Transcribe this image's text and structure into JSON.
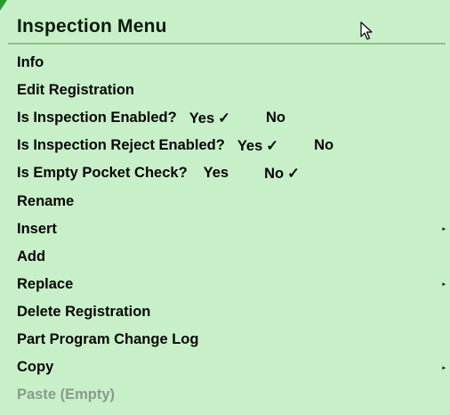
{
  "menu": {
    "title": "Inspection Menu",
    "items": [
      {
        "label": "Info"
      },
      {
        "label": "Edit Registration"
      },
      {
        "label": "Is Inspection Enabled?",
        "yes": "Yes",
        "no": "No",
        "checked": "yes",
        "check_glyph": "✓"
      },
      {
        "label": "Is Inspection Reject Enabled?",
        "yes": "Yes",
        "no": "No",
        "checked": "yes",
        "check_glyph": "✓"
      },
      {
        "label": "Is Empty Pocket Check?",
        "yes": "Yes",
        "no": "No",
        "checked": "no",
        "check_glyph": "✓"
      },
      {
        "label": "Rename"
      },
      {
        "label": "Insert",
        "submenu": true
      },
      {
        "label": "Add"
      },
      {
        "label": "Replace",
        "submenu": true
      },
      {
        "label": "Delete Registration"
      },
      {
        "label": "Part Program Change Log"
      },
      {
        "label": "Copy",
        "submenu": true
      },
      {
        "label": "Paste (Empty)",
        "disabled": true
      }
    ],
    "submenu_glyph": "▸",
    "colors": {
      "background": "#c8f0c8",
      "text": "#050505",
      "disabled_text": "#8a9a8a",
      "accent": "#2e9a2e"
    }
  }
}
